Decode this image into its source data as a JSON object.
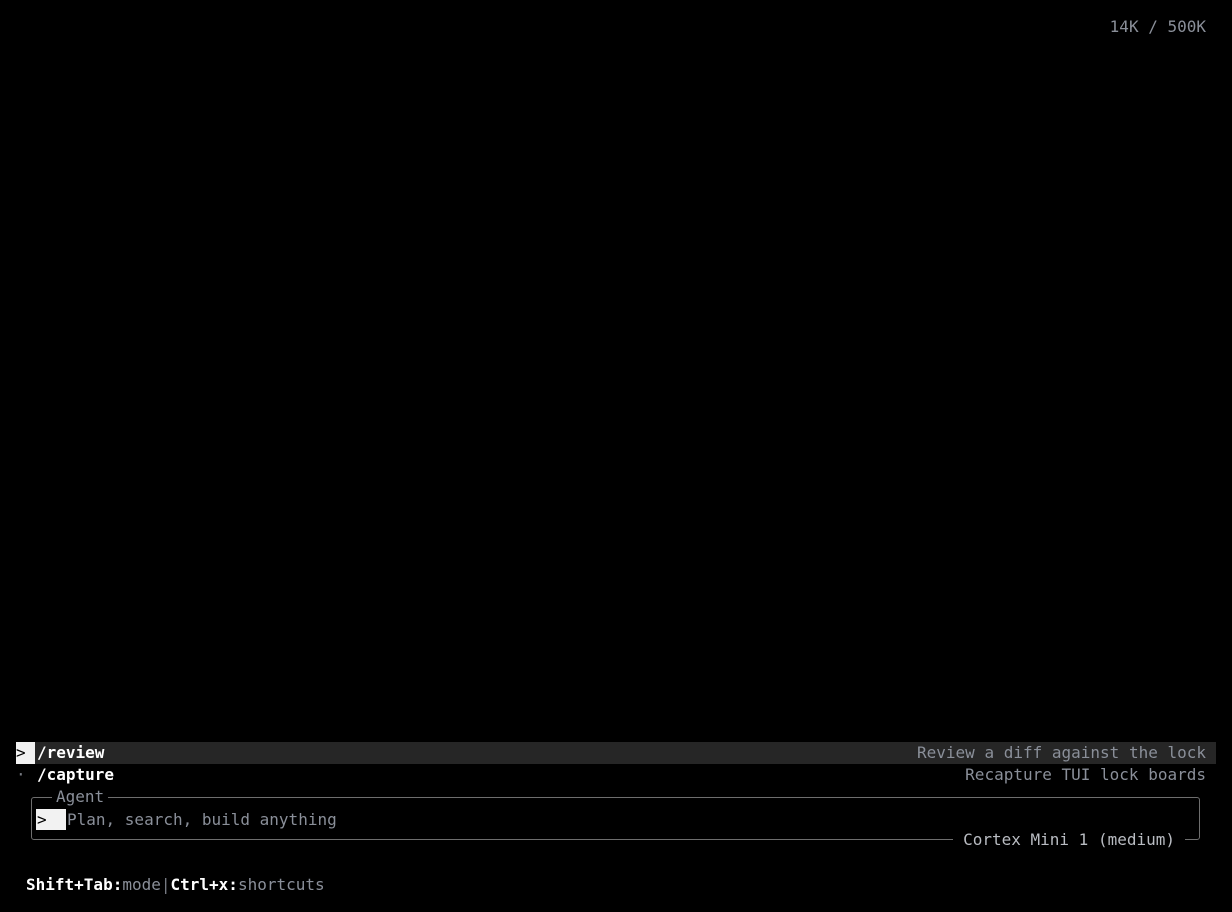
{
  "header": {
    "token_usage": "14K / 500K"
  },
  "commands": [
    {
      "marker": ">",
      "name": "/review",
      "description": "Review a diff against the lock",
      "selected": true
    },
    {
      "marker": "·",
      "name": "/capture",
      "description": "Recapture TUI lock boards",
      "selected": false
    }
  ],
  "input": {
    "mode_label": "Agent",
    "prompt_symbol": ">",
    "placeholder": "Plan, search, build anything",
    "model": "Cortex Mini 1 (medium)"
  },
  "footer": {
    "shortcut1_key": "Shift+Tab:",
    "shortcut1_action": "mode",
    "separator": "|",
    "shortcut2_key": "Ctrl+x:",
    "shortcut2_action": "shortcuts"
  }
}
